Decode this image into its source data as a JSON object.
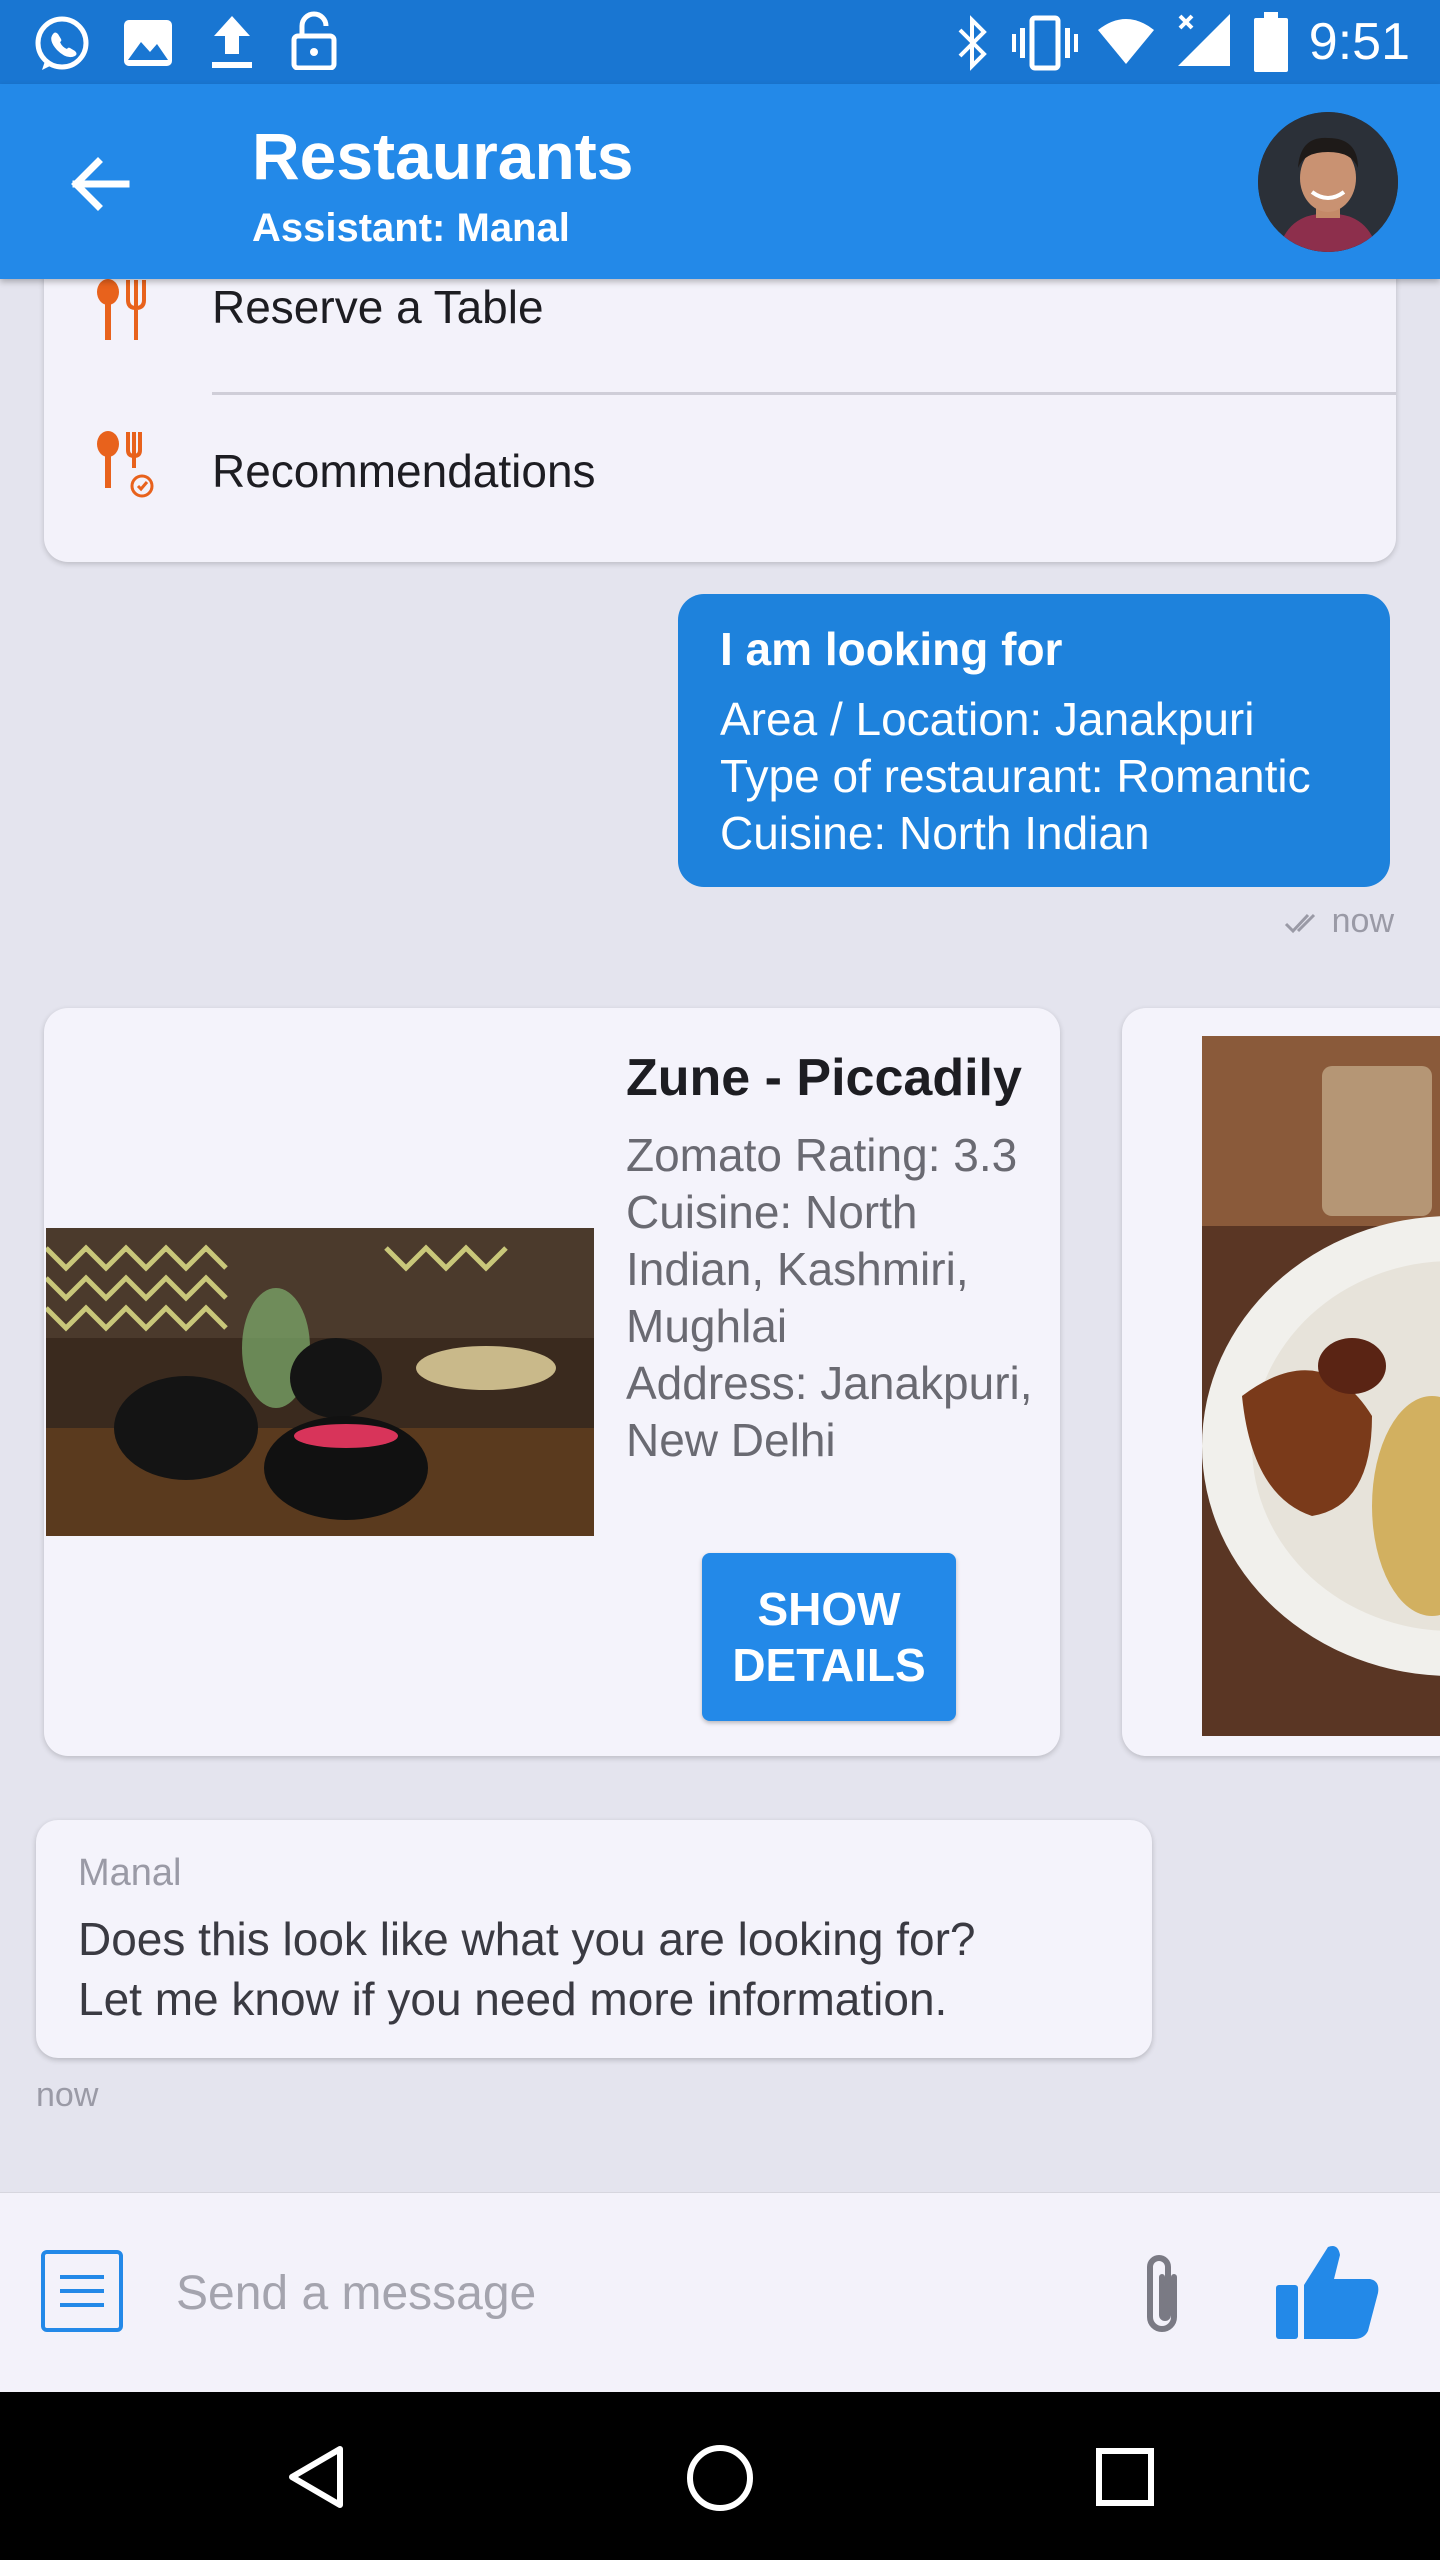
{
  "status_bar": {
    "time": "9:51",
    "left_icons": [
      "whatsapp-icon",
      "image-icon",
      "upload-icon",
      "lock-icon"
    ],
    "right_icons": [
      "bluetooth-icon",
      "vibrate-icon",
      "wifi-icon",
      "signal-icon",
      "battery-icon"
    ]
  },
  "header": {
    "title": "Restaurants",
    "subtitle": "Assistant: Manal",
    "back_icon": "arrow-left-icon",
    "avatar": "avatar"
  },
  "menu": {
    "items": [
      {
        "label": "Reserve a Table",
        "icon": "utensils-icon"
      },
      {
        "label": "Recommendations",
        "icon": "utensils-recommend-icon"
      }
    ]
  },
  "user_message": {
    "heading": "I am looking for",
    "lines": [
      "Area / Location: Janakpuri",
      "Type of restaurant: Romantic",
      "Cuisine: North Indian"
    ],
    "time": "now",
    "status_icon": "double-check-icon"
  },
  "carousel": {
    "cards": [
      {
        "title": "Zune - Piccadily",
        "lines": [
          "Zomato Rating: 3.3",
          "Cuisine: North",
          "Indian, Kashmiri,",
          "Mughlai",
          "Address: Janakpuri,",
          "New Delhi"
        ],
        "button_line1": "SHOW",
        "button_line2": "DETAILS"
      }
    ]
  },
  "bot_message": {
    "sender": "Manal",
    "lines": [
      "Does this look like what you are looking for?",
      "Let me know if you need more information."
    ],
    "time": "now"
  },
  "composer": {
    "placeholder": "Send a message",
    "menu_icon": "menu-list-icon",
    "attach_icon": "paperclip-icon",
    "like_icon": "thumbs-up-icon"
  },
  "nav_bar": {
    "icons": [
      "back-triangle-icon",
      "home-circle-icon",
      "recents-square-icon"
    ]
  },
  "colors": {
    "status_bar": "#1976d2",
    "app_bar": "#2389e8",
    "user_bubble": "#1e82dc",
    "accent_orange": "#e8621c",
    "background": "#e4e4ee"
  }
}
